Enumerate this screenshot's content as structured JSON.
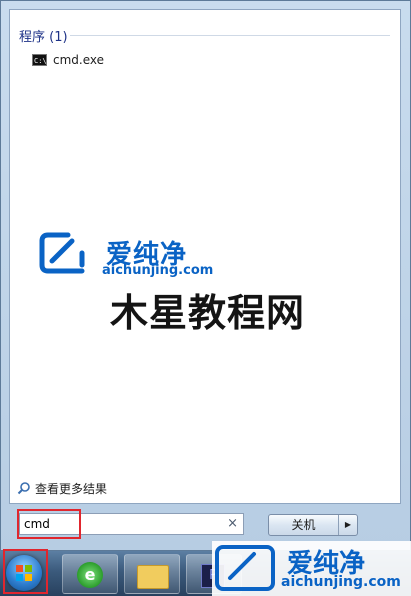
{
  "results": {
    "group_header": "程序 (1)",
    "items": [
      {
        "label": "cmd.exe",
        "icon": "command-prompt-icon"
      }
    ],
    "see_more": "查看更多结果"
  },
  "search": {
    "value": "cmd",
    "clear_glyph": "×"
  },
  "shutdown": {
    "label": "关机",
    "arrow": "▶"
  },
  "taskbar": {
    "items": [
      "start-orb",
      "internet-explorer-icon",
      "file-explorer-icon",
      "photoshop-icon"
    ]
  },
  "watermark": {
    "brand": "爱纯净",
    "domain": "aichunjing.com",
    "overlay_text": "木星教程网"
  },
  "colors": {
    "highlight_box": "#e0262e",
    "watermark_blue": "#0a63c5"
  }
}
